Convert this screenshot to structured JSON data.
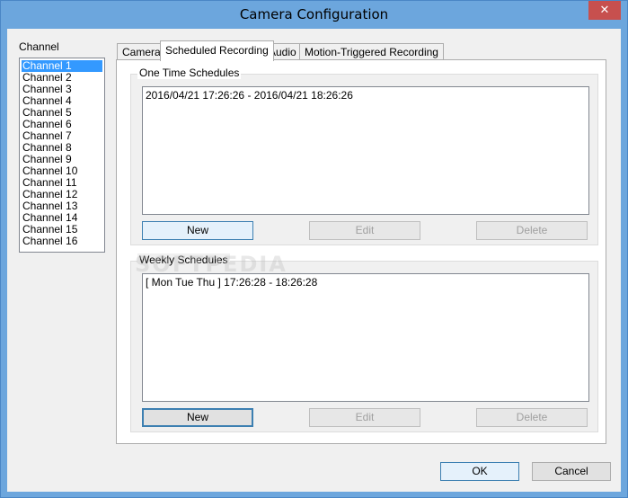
{
  "window": {
    "title": "Camera Configuration",
    "close_glyph": "✕"
  },
  "channel": {
    "label": "Channel",
    "items": [
      "Channel 1",
      "Channel 2",
      "Channel 3",
      "Channel 4",
      "Channel 5",
      "Channel 6",
      "Channel 7",
      "Channel 8",
      "Channel 9",
      "Channel 10",
      "Channel 11",
      "Channel 12",
      "Channel 13",
      "Channel 14",
      "Channel 15",
      "Channel 16"
    ],
    "selected": "Channel 1"
  },
  "tabs": [
    {
      "label": "Camera",
      "active": false
    },
    {
      "label": "Scheduled Recording",
      "active": true
    },
    {
      "label": "Audio",
      "active": false
    },
    {
      "label": "Motion-Triggered Recording",
      "active": false
    }
  ],
  "one_time": {
    "label": "One Time Schedules",
    "entries": [
      "2016/04/21 17:26:26 - 2016/04/21 18:26:26"
    ],
    "new_label": "New",
    "edit_label": "Edit",
    "delete_label": "Delete"
  },
  "weekly": {
    "label": "Weekly Schedules",
    "entries": [
      "[ Mon Tue Thu ] 17:26:28 - 18:26:28"
    ],
    "new_label": "New",
    "edit_label": "Edit",
    "delete_label": "Delete"
  },
  "dialog": {
    "ok_label": "OK",
    "cancel_label": "Cancel"
  },
  "watermark": "SOFTPEDIA"
}
